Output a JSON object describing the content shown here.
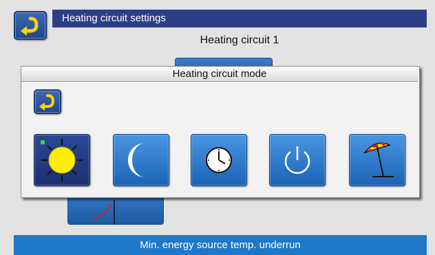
{
  "header": {
    "title": "Heating circuit settings",
    "subtitle": "Heating circuit 1"
  },
  "modal": {
    "title": "Heating circuit mode",
    "modes": [
      {
        "icon": "sun-icon",
        "selected": true
      },
      {
        "icon": "moon-icon",
        "selected": false
      },
      {
        "icon": "clock-icon",
        "selected": false
      },
      {
        "icon": "power-icon",
        "selected": false
      },
      {
        "icon": "umbrella-icon",
        "selected": false
      }
    ]
  },
  "status": {
    "message": "Min. energy source temp. underrun"
  },
  "colors": {
    "title_bar": "#2c3f86",
    "status_bar": "#1e77c7",
    "button": "#1f6dc0",
    "selected_button": "#233c85",
    "sun": "#ffee00",
    "led": "#2fe21f"
  }
}
